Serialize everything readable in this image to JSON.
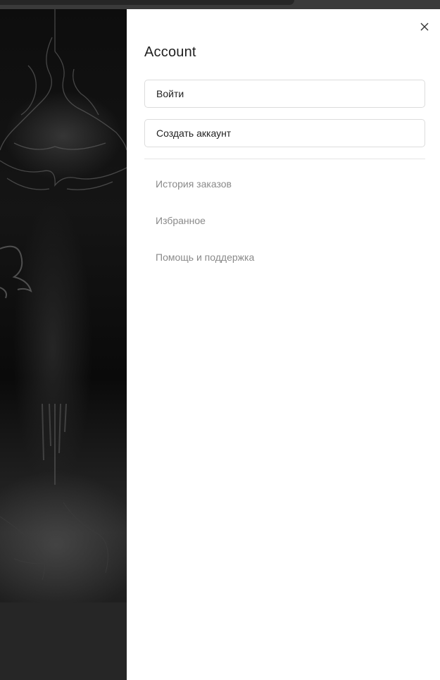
{
  "drawer": {
    "title": "Account",
    "buttons": {
      "login_label": "Войти",
      "create_account_label": "Создать аккаунт"
    },
    "menu": [
      {
        "label": "История заказов"
      },
      {
        "label": "Избранное"
      },
      {
        "label": "Помощь и поддержка"
      }
    ],
    "close_icon": "close-icon"
  },
  "colors": {
    "drawer_bg": "#ffffff",
    "title_text": "#1f1f1f",
    "button_border": "#dcdcdc",
    "menu_text": "#8a8a8a",
    "backdrop_dark": "#0d0d0d"
  }
}
